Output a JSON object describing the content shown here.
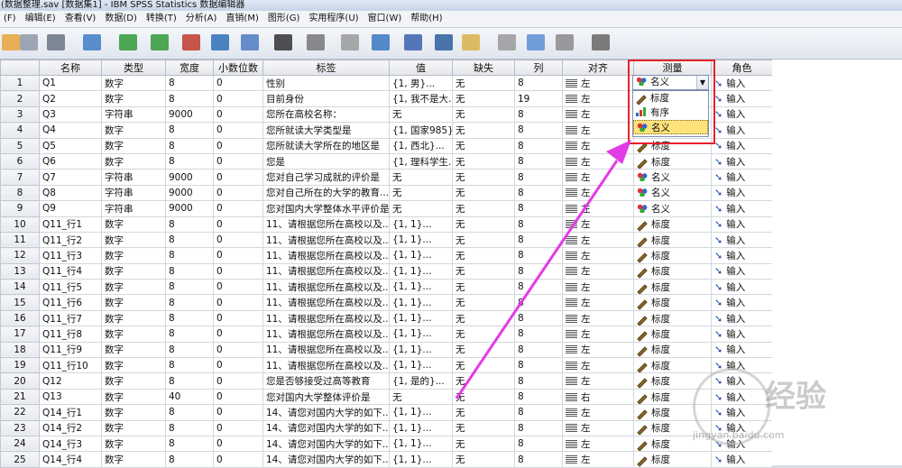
{
  "title": "(数据整理.sav [数据集1] - IBM SPSS Statistics 数据编辑器",
  "menu": [
    "(F)",
    "编辑(E)",
    "查看(V)",
    "数据(D)",
    "转换(T)",
    "分析(A)",
    "直销(M)",
    "图形(G)",
    "实用程序(U)",
    "窗口(W)",
    "帮助(H)"
  ],
  "toolbar_icons": [
    "open-icon",
    "save-icon",
    "print-icon",
    "recall-dialog-icon",
    "undo-icon",
    "redo-icon",
    "goto-case-icon",
    "goto-variable-icon",
    "variables-icon",
    "run-descriptive-icon",
    "find-icon",
    "insert-cases-icon",
    "insert-variable-icon",
    "split-file-icon",
    "weight-cases-icon",
    "select-cases-icon",
    "value-labels-icon",
    "use-variable-sets-icon",
    "show-all-variables-icon",
    "spell-check-icon"
  ],
  "columns": [
    "",
    "名称",
    "类型",
    "宽度",
    "小数位数",
    "标签",
    "值",
    "缺失",
    "列",
    "对齐",
    "测量",
    "角色"
  ],
  "rows": [
    {
      "n": "1",
      "name": "Q1",
      "type": "数字",
      "width": "8",
      "dec": "0",
      "label": "性别",
      "values": "{1, 男}...",
      "missing": "无",
      "cols": "8",
      "align": "左",
      "measure": "名义",
      "measure_icon": "nominal",
      "role": "输入"
    },
    {
      "n": "2",
      "name": "Q2",
      "type": "数字",
      "width": "8",
      "dec": "0",
      "label": "目前身份",
      "values": "{1, 我不是大...",
      "missing": "无",
      "cols": "19",
      "align": "左",
      "measure": "名义",
      "measure_icon": "nominal",
      "role": "输入"
    },
    {
      "n": "3",
      "name": "Q3",
      "type": "字符串",
      "width": "9000",
      "dec": "0",
      "label": "您所在高校名称：",
      "values": "无",
      "missing": "无",
      "cols": "8",
      "align": "左",
      "measure": "名义",
      "measure_icon": "nominal",
      "role": "输入"
    },
    {
      "n": "4",
      "name": "Q4",
      "type": "数字",
      "width": "8",
      "dec": "0",
      "label": "您所就读大学类型是",
      "values": "{1, 国家985}...",
      "missing": "无",
      "cols": "8",
      "align": "左",
      "measure": "名义",
      "measure_icon": "nominal",
      "role": "输入"
    },
    {
      "n": "5",
      "name": "Q5",
      "type": "数字",
      "width": "8",
      "dec": "0",
      "label": "您所就读大学所在的地区是",
      "values": "{1, 西北}...",
      "missing": "无",
      "cols": "8",
      "align": "左",
      "measure": "标度",
      "measure_icon": "scale",
      "role": "输入"
    },
    {
      "n": "6",
      "name": "Q6",
      "type": "数字",
      "width": "8",
      "dec": "0",
      "label": "您是",
      "values": "{1, 理科学生...",
      "missing": "无",
      "cols": "8",
      "align": "左",
      "measure": "标度",
      "measure_icon": "scale",
      "role": "输入"
    },
    {
      "n": "7",
      "name": "Q7",
      "type": "字符串",
      "width": "9000",
      "dec": "0",
      "label": "您对自己学习成就的评价是",
      "values": "无",
      "missing": "无",
      "cols": "8",
      "align": "左",
      "measure": "名义",
      "measure_icon": "nominal",
      "role": "输入"
    },
    {
      "n": "8",
      "name": "Q8",
      "type": "字符串",
      "width": "9000",
      "dec": "0",
      "label": "您对自己所在的大学的教育...",
      "values": "无",
      "missing": "无",
      "cols": "8",
      "align": "左",
      "measure": "名义",
      "measure_icon": "nominal",
      "role": "输入"
    },
    {
      "n": "9",
      "name": "Q9",
      "type": "字符串",
      "width": "9000",
      "dec": "0",
      "label": "您对国内大学整体水平评价是",
      "values": "无",
      "missing": "无",
      "cols": "8",
      "align": "左",
      "measure": "名义",
      "measure_icon": "nominal",
      "role": "输入"
    },
    {
      "n": "10",
      "name": "Q11_行1",
      "type": "数字",
      "width": "8",
      "dec": "0",
      "label": "11、请根据您所在高校以及...",
      "values": "{1, 1}...",
      "missing": "无",
      "cols": "8",
      "align": "左",
      "measure": "标度",
      "measure_icon": "scale",
      "role": "输入"
    },
    {
      "n": "11",
      "name": "Q11_行2",
      "type": "数字",
      "width": "8",
      "dec": "0",
      "label": "11、请根据您所在高校以及...",
      "values": "{1, 1}...",
      "missing": "无",
      "cols": "8",
      "align": "左",
      "measure": "标度",
      "measure_icon": "scale",
      "role": "输入"
    },
    {
      "n": "12",
      "name": "Q11_行3",
      "type": "数字",
      "width": "8",
      "dec": "0",
      "label": "11、请根据您所在高校以及...",
      "values": "{1, 1}...",
      "missing": "无",
      "cols": "8",
      "align": "左",
      "measure": "标度",
      "measure_icon": "scale",
      "role": "输入"
    },
    {
      "n": "13",
      "name": "Q11_行4",
      "type": "数字",
      "width": "8",
      "dec": "0",
      "label": "11、请根据您所在高校以及...",
      "values": "{1, 1}...",
      "missing": "无",
      "cols": "8",
      "align": "左",
      "measure": "标度",
      "measure_icon": "scale",
      "role": "输入"
    },
    {
      "n": "14",
      "name": "Q11_行5",
      "type": "数字",
      "width": "8",
      "dec": "0",
      "label": "11、请根据您所在高校以及...",
      "values": "{1, 1}...",
      "missing": "无",
      "cols": "8",
      "align": "左",
      "measure": "标度",
      "measure_icon": "scale",
      "role": "输入"
    },
    {
      "n": "15",
      "name": "Q11_行6",
      "type": "数字",
      "width": "8",
      "dec": "0",
      "label": "11、请根据您所在高校以及...",
      "values": "{1, 1}...",
      "missing": "无",
      "cols": "8",
      "align": "左",
      "measure": "标度",
      "measure_icon": "scale",
      "role": "输入"
    },
    {
      "n": "16",
      "name": "Q11_行7",
      "type": "数字",
      "width": "8",
      "dec": "0",
      "label": "11、请根据您所在高校以及...",
      "values": "{1, 1}...",
      "missing": "无",
      "cols": "8",
      "align": "左",
      "measure": "标度",
      "measure_icon": "scale",
      "role": "输入"
    },
    {
      "n": "17",
      "name": "Q11_行8",
      "type": "数字",
      "width": "8",
      "dec": "0",
      "label": "11、请根据您所在高校以及...",
      "values": "{1, 1}...",
      "missing": "无",
      "cols": "8",
      "align": "左",
      "measure": "标度",
      "measure_icon": "scale",
      "role": "输入"
    },
    {
      "n": "18",
      "name": "Q11_行9",
      "type": "数字",
      "width": "8",
      "dec": "0",
      "label": "11、请根据您所在高校以及...",
      "values": "{1, 1}...",
      "missing": "无",
      "cols": "8",
      "align": "左",
      "measure": "标度",
      "measure_icon": "scale",
      "role": "输入"
    },
    {
      "n": "19",
      "name": "Q11_行10",
      "type": "数字",
      "width": "8",
      "dec": "0",
      "label": "11、请根据您所在高校以及...",
      "values": "{1, 1}...",
      "missing": "无",
      "cols": "8",
      "align": "左",
      "measure": "标度",
      "measure_icon": "scale",
      "role": "输入"
    },
    {
      "n": "20",
      "name": "Q12",
      "type": "数字",
      "width": "8",
      "dec": "0",
      "label": "您是否够接受过高等教育",
      "values": "{1, 是的}...",
      "missing": "无",
      "cols": "8",
      "align": "左",
      "measure": "标度",
      "measure_icon": "scale",
      "role": "输入"
    },
    {
      "n": "21",
      "name": "Q13",
      "type": "数字",
      "width": "40",
      "dec": "0",
      "label": "您对国内大学整体评价是",
      "values": "无",
      "missing": "无",
      "cols": "8",
      "align": "右",
      "measure": "标度",
      "measure_icon": "scale",
      "role": "输入"
    },
    {
      "n": "22",
      "name": "Q14_行1",
      "type": "数字",
      "width": "8",
      "dec": "0",
      "label": "14、请您对国内大学的如下...",
      "values": "{1, 1}...",
      "missing": "无",
      "cols": "8",
      "align": "左",
      "measure": "标度",
      "measure_icon": "scale",
      "role": "输入"
    },
    {
      "n": "23",
      "name": "Q14_行2",
      "type": "数字",
      "width": "8",
      "dec": "0",
      "label": "14、请您对国内大学的如下...",
      "values": "{1, 1}...",
      "missing": "无",
      "cols": "8",
      "align": "左",
      "measure": "标度",
      "measure_icon": "scale",
      "role": "输入"
    },
    {
      "n": "24",
      "name": "Q14_行3",
      "type": "数字",
      "width": "8",
      "dec": "0",
      "label": "14、请您对国内大学的如下...",
      "values": "{1, 1}...",
      "missing": "无",
      "cols": "8",
      "align": "左",
      "measure": "标度",
      "measure_icon": "scale",
      "role": "输入"
    },
    {
      "n": "25",
      "name": "Q14_行4",
      "type": "数字",
      "width": "8",
      "dec": "0",
      "label": "14、请您对国内大学的如下...",
      "values": "{1, 1}...",
      "missing": "无",
      "cols": "8",
      "align": "左",
      "measure": "标度",
      "measure_icon": "scale",
      "role": "输入"
    }
  ],
  "measure_dropdown": {
    "current": "名义",
    "options": [
      {
        "label": "标度",
        "icon": "scale"
      },
      {
        "label": "有序",
        "icon": "ordinal"
      },
      {
        "label": "名义",
        "icon": "nominal",
        "selected": true
      }
    ]
  },
  "watermark": {
    "text": "经验",
    "url": "jingyan.baidu.com"
  },
  "colors": {
    "highlight": "#e4222b",
    "arrow": "#e23ce6",
    "selected_option": "#ffe27c"
  }
}
